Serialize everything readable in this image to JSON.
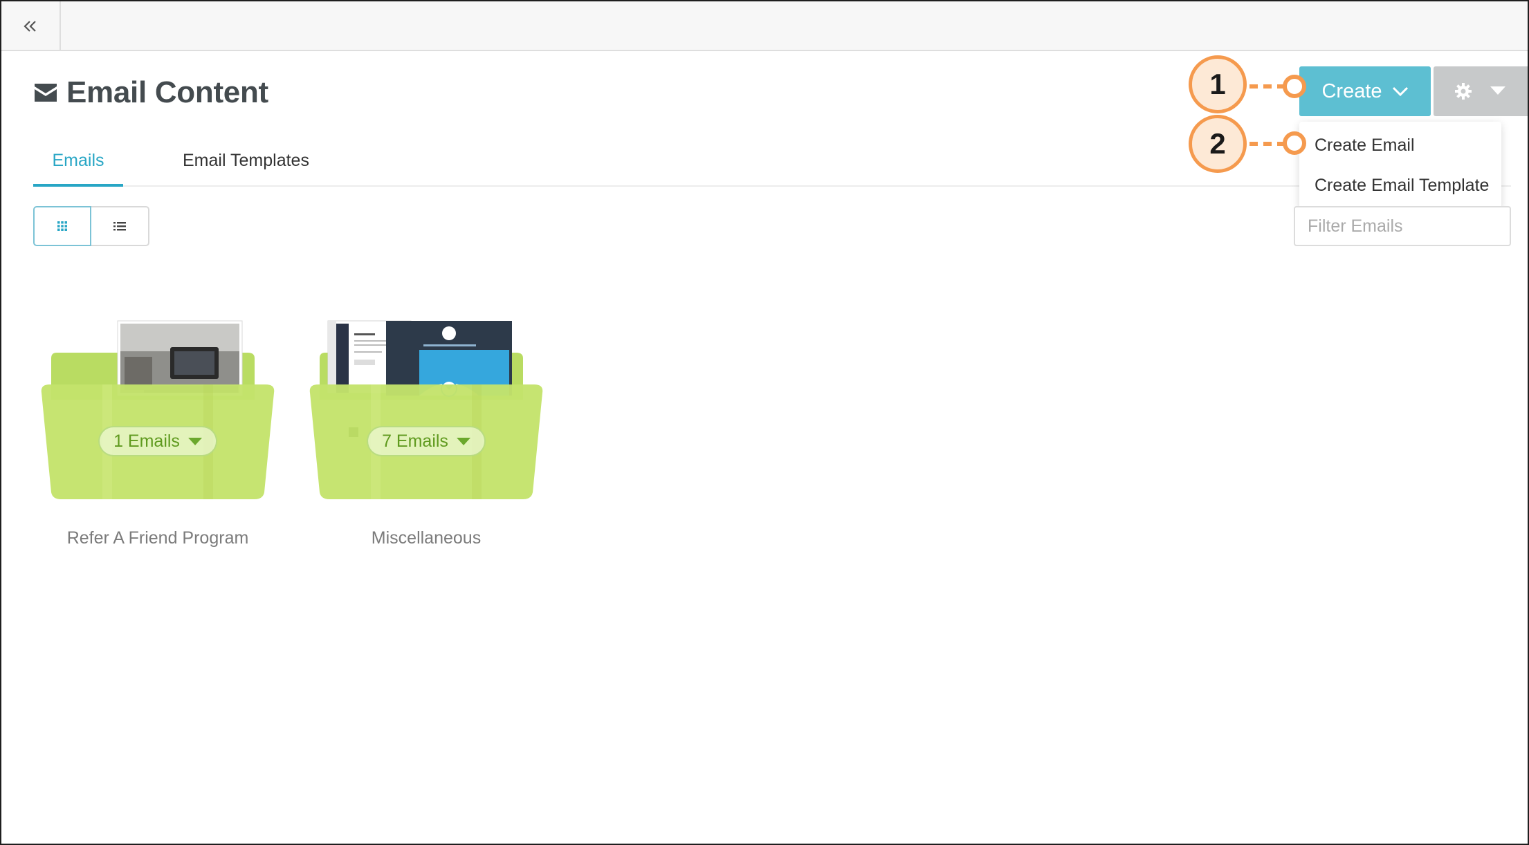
{
  "topbar": {
    "collapse_icon": "double-chevron-left-icon"
  },
  "header": {
    "title": "Email Content",
    "title_icon": "envelope-icon"
  },
  "tabs": [
    {
      "label": "Emails",
      "active": true
    },
    {
      "label": "Email Templates",
      "active": false
    }
  ],
  "view_toggle": {
    "grid_icon": "grid-icon",
    "list_icon": "list-icon",
    "active": "grid"
  },
  "actions": {
    "create_label": "Create",
    "settings_icon": "gear-icon",
    "dropdown_items": [
      "Create Email",
      "Create Email Template"
    ]
  },
  "filter": {
    "placeholder": "Filter Emails",
    "value": ""
  },
  "callouts": [
    "1",
    "2"
  ],
  "folders": [
    {
      "name": "Refer A Friend Program",
      "count_label": "1 Emails"
    },
    {
      "name": "Miscellaneous",
      "count_label": "7 Emails"
    }
  ],
  "colors": {
    "accent": "#28a6c5",
    "create_button": "#5dbfd2",
    "folder": "#c4e36b",
    "callout": "#f59a4e"
  }
}
